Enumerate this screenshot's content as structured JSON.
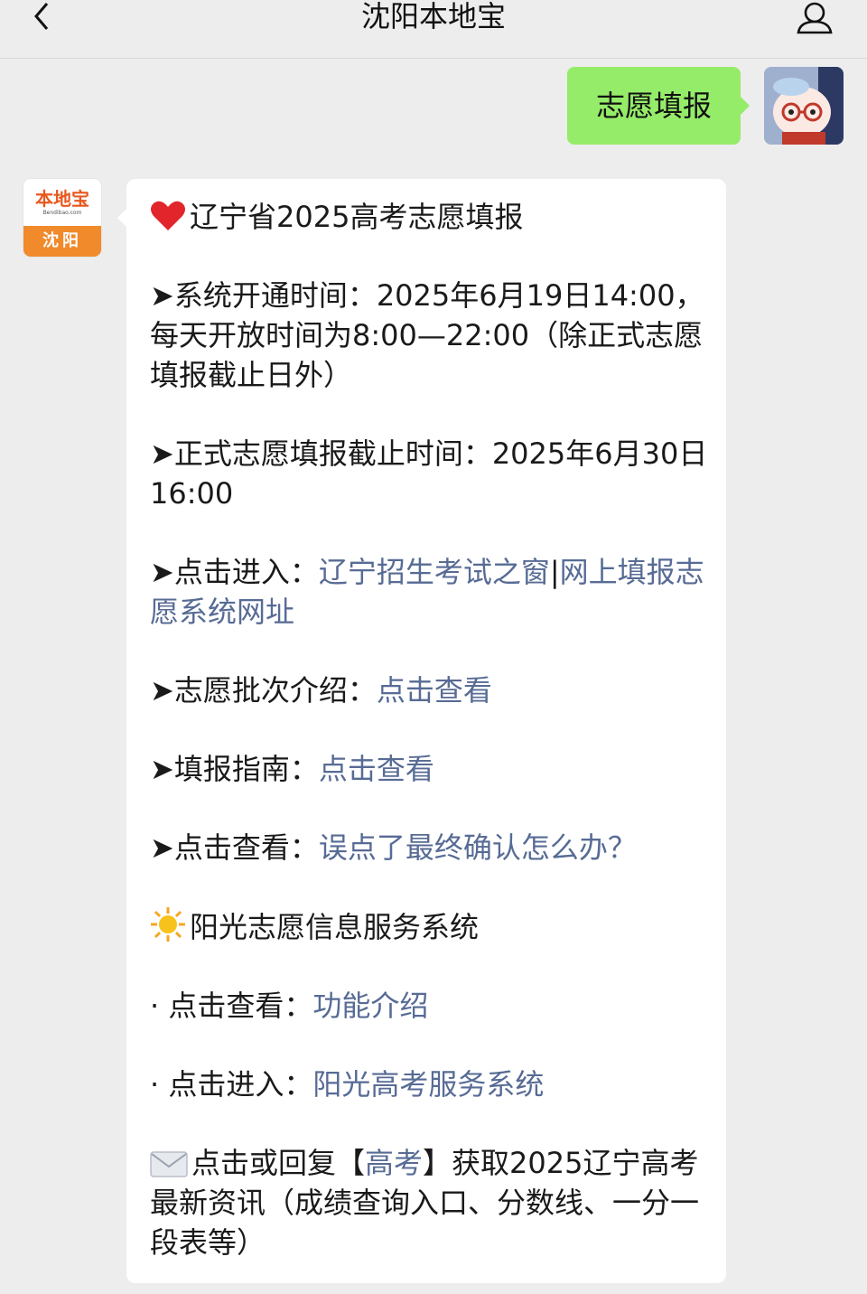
{
  "header": {
    "title": "沈阳本地宝"
  },
  "chat": {
    "user_message": "志愿填报",
    "sender_avatar": {
      "logo_text": "本地宝",
      "logo_sub": "Bendibao.com",
      "city": "沈阳"
    },
    "reply": {
      "heading": "辽宁省2025高考志愿填报",
      "p1": "➤系统开通时间：2025年6月19日14:00，每天开放时间为8:00—22:00（除正式志愿填报截止日外）",
      "p2": "➤正式志愿填报截止时间：2025年6月30日16:00",
      "p3": {
        "label": "➤点击进入：",
        "link1": "辽宁招生考试之窗",
        "sep": "|",
        "link2": "网上填报志愿系统网址"
      },
      "p4": {
        "label": "➤志愿批次介绍：",
        "link": "点击查看"
      },
      "p5": {
        "label": "➤填报指南：",
        "link": "点击查看"
      },
      "p6": {
        "label": "➤点击查看：",
        "link": "误点了最终确认怎么办？"
      },
      "sunshine_heading": "阳光志愿信息服务系统",
      "p7": {
        "label": "· 点击查看：",
        "link": "功能介绍"
      },
      "p8": {
        "label": "· 点击进入：",
        "link": "阳光高考服务系统"
      },
      "p9": {
        "prefix": "点击或回复【",
        "link": "高考",
        "suffix": "】获取2025辽宁高考最新资讯（成绩查询入口、分数线、一分一段表等）"
      }
    }
  },
  "colors": {
    "background": "#ededed",
    "user_bubble": "#95ec69",
    "link": "#576b95",
    "logo_orange": "#f08a2b"
  },
  "icons": [
    "back-arrow-icon",
    "profile-icon",
    "heart-icon",
    "sun-icon",
    "envelope-icon"
  ]
}
